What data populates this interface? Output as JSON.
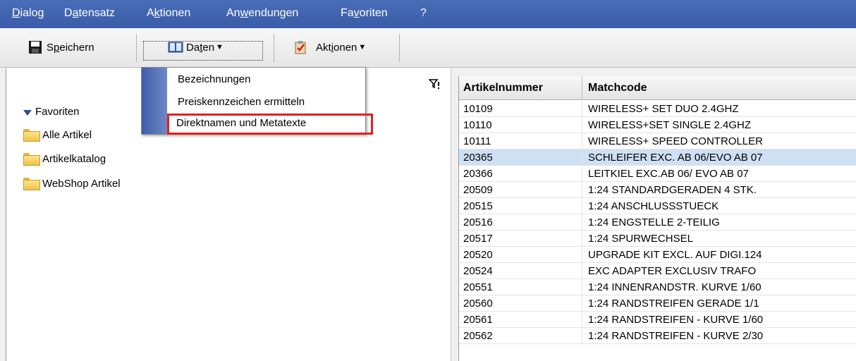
{
  "menubar": {
    "items": [
      {
        "pre": "",
        "u": "D",
        "post": "ialog"
      },
      {
        "pre": "D",
        "u": "a",
        "post": "tensatz"
      },
      {
        "pre": "A",
        "u": "k",
        "post": "tionen"
      },
      {
        "pre": "An",
        "u": "w",
        "post": "endungen"
      },
      {
        "pre": "Fa",
        "u": "v",
        "post": "oriten"
      },
      {
        "pre": "",
        "u": "",
        "post": "?"
      }
    ]
  },
  "toolbar": {
    "save": {
      "pre": "S",
      "u": "p",
      "post": "eichern"
    },
    "daten": {
      "pre": "Da",
      "u": "t",
      "post": "en"
    },
    "aktionen": {
      "pre": "Akt",
      "u": "i",
      "post": "onen"
    }
  },
  "dropdown": {
    "items": [
      "Bezeichnungen",
      "Preiskennzeichen ermitteln",
      "Direktnamen und Metatexte"
    ]
  },
  "tree": {
    "items": [
      "Favoriten",
      "Alle Artikel",
      "Artikelkatalog",
      "WebShop Artikel"
    ]
  },
  "grid": {
    "columns": [
      "Artikelnummer",
      "Matchcode"
    ],
    "rows": [
      [
        "10109",
        "WIRELESS+ SET DUO 2.4GHZ"
      ],
      [
        "10110",
        "WIRELESS+SET SINGLE 2.4GHZ"
      ],
      [
        "10111",
        "WIRELESS+ SPEED CONTROLLER"
      ],
      [
        "20365",
        "SCHLEIFER EXC. AB 06/EVO AB 07"
      ],
      [
        "20366",
        "LEITKIEL EXC.AB 06/ EVO AB 07"
      ],
      [
        "20509",
        "1:24 STANDARDGERADEN 4 STK."
      ],
      [
        "20515",
        "1:24 ANSCHLUSSSTUECK"
      ],
      [
        "20516",
        "1:24 ENGSTELLE 2-TEILIG"
      ],
      [
        "20517",
        "1:24 SPURWECHSEL"
      ],
      [
        "20520",
        "UPGRADE KIT EXCL. AUF DIGI.124"
      ],
      [
        "20524",
        "EXC ADAPTER EXCLUSIV TRAFO"
      ],
      [
        "20551",
        "1:24 INNENRANDSTR. KURVE 1/60"
      ],
      [
        "20560",
        "1:24 RANDSTREIFEN GERADE 1/1"
      ],
      [
        "20561",
        "1:24 RANDSTREIFEN - KURVE 1/60"
      ],
      [
        "20562",
        "1:24 RANDSTREIFEN - KURVE 2/30"
      ]
    ],
    "selected_row": 3
  },
  "colors": {
    "menubar": "#3f62ae",
    "selection": "#cfe0f5",
    "highlight_box": "#e02020"
  }
}
